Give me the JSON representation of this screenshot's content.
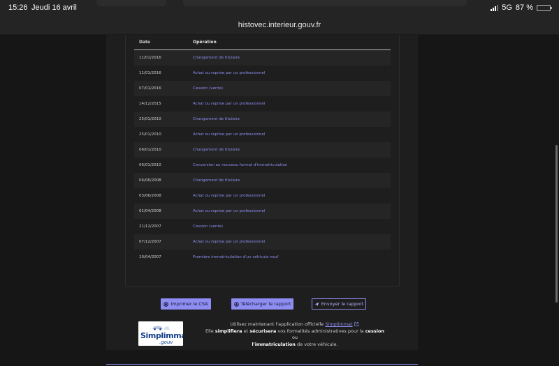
{
  "status": {
    "time": "15:26",
    "date": "Jeudi 16 avril",
    "network": "5G",
    "battery": "87 %",
    "battery_level": 0.87
  },
  "browser": {
    "url": "histovec.interieur.gouv.fr"
  },
  "history": {
    "header": {
      "date": "Date",
      "operation": "Opération"
    },
    "rows": [
      {
        "date": "11/01/2016",
        "operation": "Changement de titulaire"
      },
      {
        "date": "11/01/2016",
        "operation": "Achat ou reprise par un professionnel"
      },
      {
        "date": "07/01/2016",
        "operation": "Cession (vente)"
      },
      {
        "date": "14/12/2015",
        "operation": "Achat ou reprise par un professionnel"
      },
      {
        "date": "25/01/2010",
        "operation": "Changement de titulaire"
      },
      {
        "date": "25/01/2010",
        "operation": "Achat ou reprise par un professionnel"
      },
      {
        "date": "06/01/2010",
        "operation": "Changement de titulaire"
      },
      {
        "date": "06/01/2010",
        "operation": "Conversion au nouveau format d'immatriculation"
      },
      {
        "date": "06/06/2008",
        "operation": "Changement de titulaire"
      },
      {
        "date": "03/06/2008",
        "operation": "Achat ou reprise par un professionnel"
      },
      {
        "date": "01/04/2008",
        "operation": "Achat ou reprise par un professionnel"
      },
      {
        "date": "21/12/2007",
        "operation": "Cession (vente)"
      },
      {
        "date": "07/12/2007",
        "operation": "Achat ou reprise par un professionnel"
      },
      {
        "date": "10/04/2007",
        "operation": "Première immatriculation d'un véhicule neuf"
      }
    ]
  },
  "actions": {
    "print_label": "Imprimer le CSA",
    "download_label": "Télécharger le rapport",
    "send_label": "Envoyer le rapport",
    "print_icon": "print-icon",
    "download_icon": "download-icon",
    "send_icon": "send-icon"
  },
  "promo": {
    "logo_word": "Simplimmat",
    "logo_gouv": ".gouv",
    "line1_prefix": "Utilisez maintenant l'application officielle",
    "link": "Simplimmat",
    "line1_suffix": ".",
    "line2_a": "Elle",
    "line2_b": "simplifiera",
    "line2_c": "et",
    "line2_d": "sécurisera",
    "line2_e": "vos formalités administratives pour la",
    "line2_f": "cession",
    "line2_g": "ou",
    "line3_a": "l'immatriculation",
    "line3_b": "de votre véhicule."
  },
  "colors": {
    "accent": "#8d8df2",
    "page_bg": "#161616",
    "panel_bg": "#1e1e1e"
  }
}
